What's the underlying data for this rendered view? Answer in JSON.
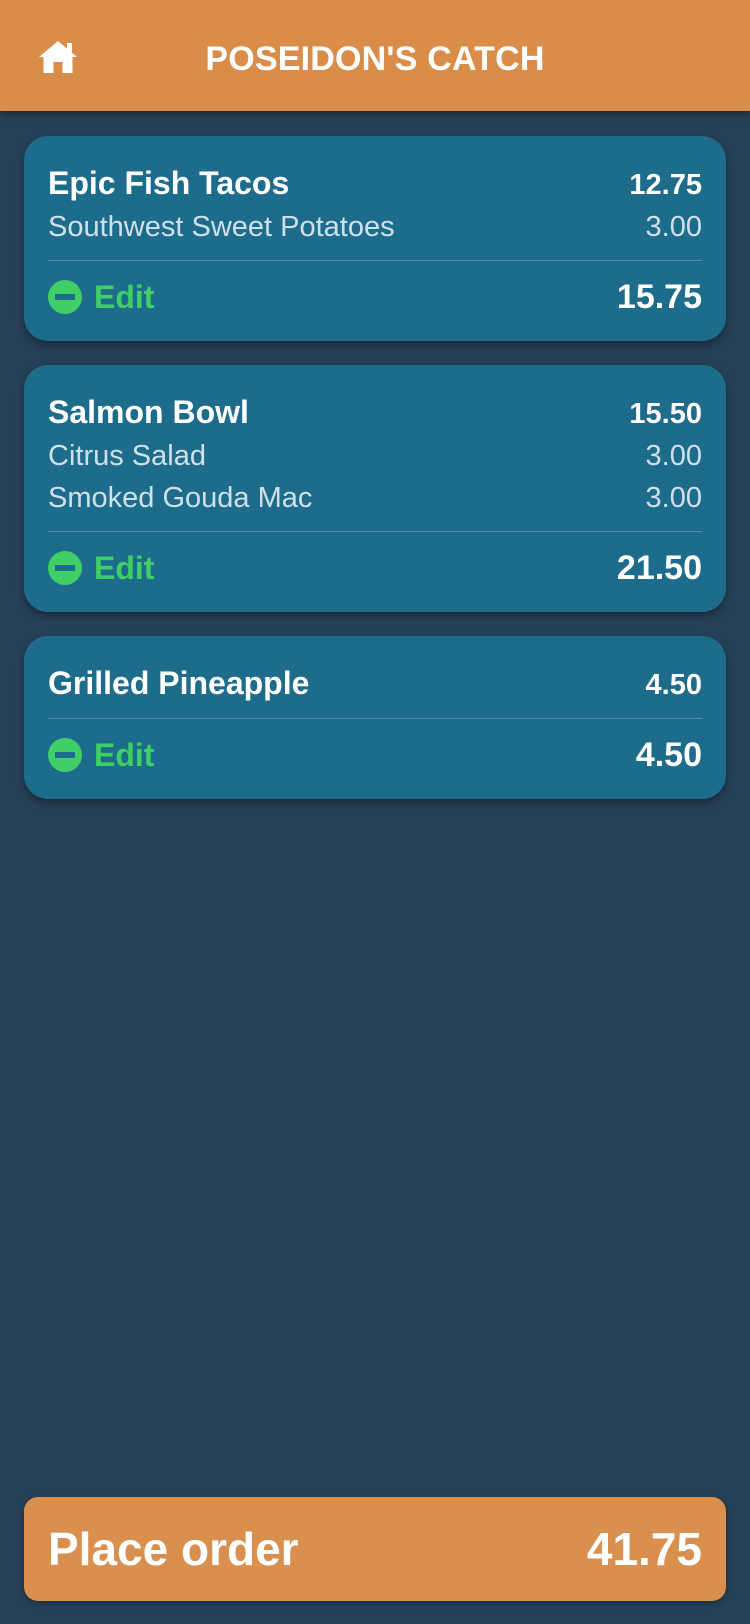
{
  "header": {
    "title": "POSEIDON'S CATCH",
    "home_icon": "home-icon"
  },
  "colors": {
    "header_bg": "#d98d48",
    "page_bg": "#264057",
    "card_bg": "#1e6c8c",
    "edit_green": "#3fcf66",
    "button_bg": "#d98f4e"
  },
  "cart": {
    "items": [
      {
        "name": "Epic Fish Tacos",
        "price": "12.75",
        "addons": [
          {
            "name": "Southwest Sweet Potatoes",
            "price": "3.00"
          }
        ],
        "edit_label": "Edit",
        "total": "15.75"
      },
      {
        "name": "Salmon Bowl",
        "price": "15.50",
        "addons": [
          {
            "name": "Citrus Salad",
            "price": "3.00"
          },
          {
            "name": "Smoked Gouda Mac",
            "price": "3.00"
          }
        ],
        "edit_label": "Edit",
        "total": "21.50"
      },
      {
        "name": "Grilled Pineapple",
        "price": "4.50",
        "addons": [],
        "edit_label": "Edit",
        "total": "4.50"
      }
    ]
  },
  "place_order": {
    "label": "Place order",
    "total": "41.75"
  }
}
